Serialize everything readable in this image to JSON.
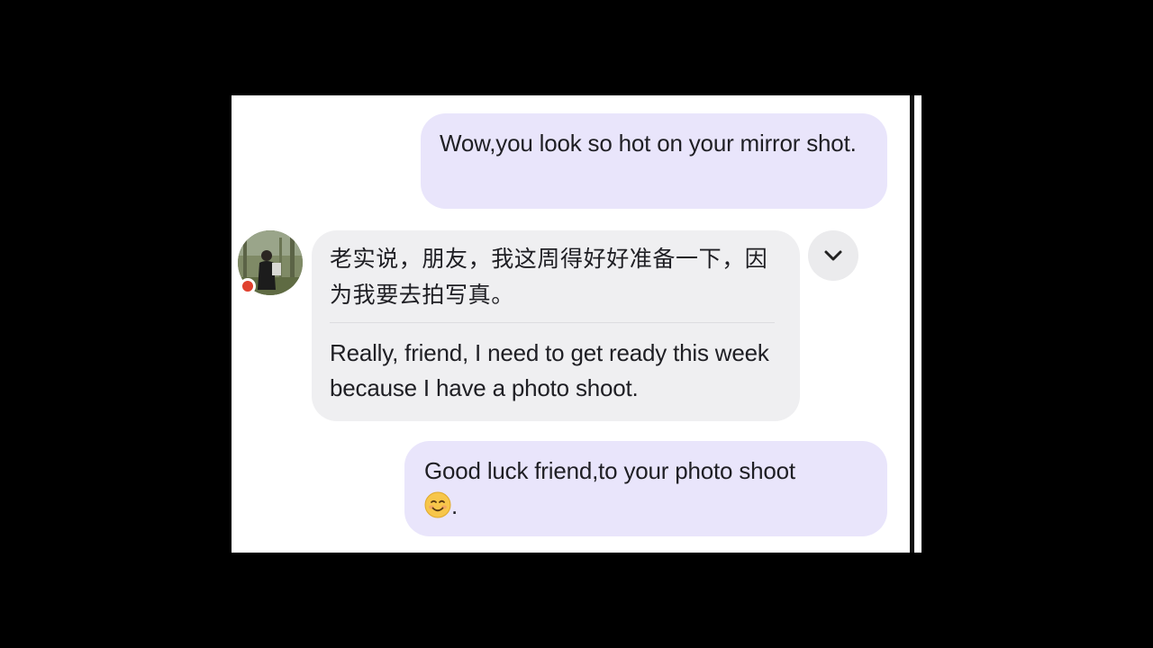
{
  "messages": [
    {
      "direction": "sent",
      "text": "Wow,you look so hot on your mirror shot."
    },
    {
      "direction": "received",
      "original": "老实说，朋友，我这周得好好准备一下，因为我要去拍写真。",
      "translation": "Really, friend, I need to get ready this week because I have a photo shoot."
    },
    {
      "direction": "sent",
      "text": "Good luck friend,to your photo shoot",
      "emoji": "smiling-face-icon",
      "trailing": "."
    }
  ],
  "contact": {
    "presence": "online",
    "presence_color": "#e0402e"
  },
  "colors": {
    "sent_bubble": "#e9e5fb",
    "received_bubble": "#efeff1",
    "text": "#1f1f24"
  },
  "icons": {
    "more_options": "chevron-down-icon"
  }
}
